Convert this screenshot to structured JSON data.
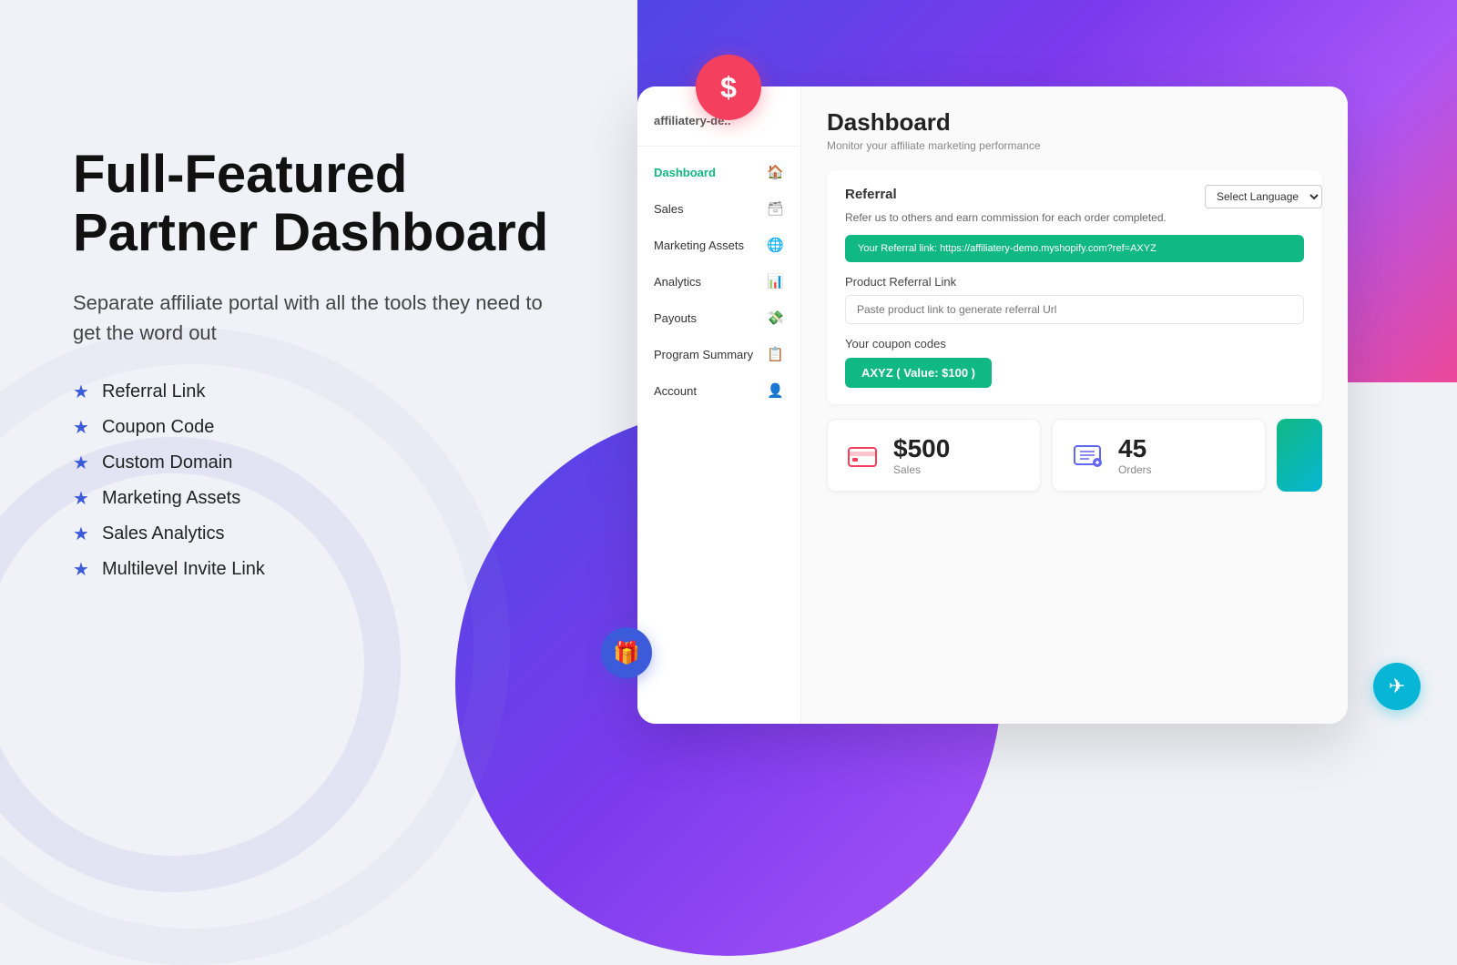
{
  "page": {
    "background_gradient": true,
    "left": {
      "hero_title": "Full-Featured Partner Dashboard",
      "hero_subtitle": "Separate affiliate portal with all the tools they need to get the word out",
      "features": [
        "Referral Link",
        "Coupon Code",
        "Custom Domain",
        "Marketing Assets",
        "Sales Analytics",
        "Multilevel Invite Link"
      ]
    },
    "dollar_badge": "$",
    "gift_badge": "🎁",
    "send_badge": "➤",
    "dashboard": {
      "brand": "affiliatery-de..",
      "language_select_label": "Select Language",
      "nav_items": [
        {
          "label": "Dashboard",
          "icon": "🏠",
          "active": true
        },
        {
          "label": "Sales",
          "icon": "🗃",
          "active": false
        },
        {
          "label": "Marketing Assets",
          "icon": "🌐",
          "active": false
        },
        {
          "label": "Analytics",
          "icon": "📊",
          "active": false
        },
        {
          "label": "Payouts",
          "icon": "💸",
          "active": false
        },
        {
          "label": "Program Summary",
          "icon": "📋",
          "active": false
        },
        {
          "label": "Account",
          "icon": "👤",
          "active": false
        }
      ],
      "main": {
        "title": "Dashboard",
        "subtitle": "Monitor your affiliate marketing performance",
        "referral_section_title": "Referral",
        "referral_description": "Refer us to others and earn commission for each order completed.",
        "referral_link": "Your Referral link: https://affiliatery-demo.myshopify.com?ref=AXYZ",
        "product_link_label": "Product Referral Link",
        "product_link_placeholder": "Paste product link to generate referral Url",
        "coupon_label": "Your coupon codes",
        "coupon_code": "AXYZ ( Value: $100 )",
        "stats": [
          {
            "icon": "💳",
            "icon_type": "sales",
            "value": "$500",
            "label": "Sales"
          },
          {
            "icon": "🛒",
            "icon_type": "orders",
            "value": "45",
            "label": "Orders"
          }
        ]
      }
    }
  }
}
